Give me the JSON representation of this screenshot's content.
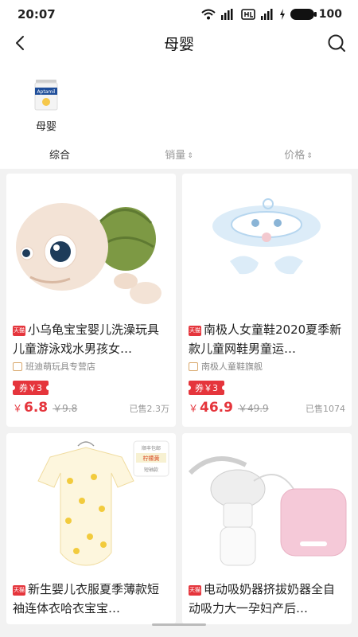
{
  "status_bar": {
    "time": "20:07",
    "battery": "100"
  },
  "header": {
    "title": "母婴"
  },
  "category": {
    "label": "母婴",
    "thumb_brand": "Aptamil"
  },
  "sort_tabs": [
    {
      "label": "综合"
    },
    {
      "label": "销量",
      "arrows": "⇕"
    },
    {
      "label": "价格",
      "arrows": "⇕"
    }
  ],
  "tmall_badge": "天猫",
  "products": [
    {
      "title": "小乌龟宝宝婴儿洗澡玩具儿童游泳戏水男孩女…",
      "shop": "班迪萌玩具专营店",
      "coupon": "券￥3",
      "price_symbol": "￥",
      "price": "6.8",
      "original_price": "￥9.8",
      "sold": "已售2.3万"
    },
    {
      "title": "南极人女童鞋2020夏季新款儿童网鞋男童运…",
      "shop": "南极人童鞋旗舰",
      "coupon": "券￥3",
      "price_symbol": "￥",
      "price": "46.9",
      "original_price": "￥49.9",
      "sold": "已售1074"
    },
    {
      "title": "新生婴儿衣服夏季薄款短袖连体衣哈衣宝宝…",
      "image_tag_top": "顺丰包邮",
      "image_tag_mid": "柠檬黄",
      "image_tag_bot": "短袖款"
    },
    {
      "title": "电动吸奶器挤拔奶器全自动吸力大一孕妇产后…"
    }
  ],
  "colors": {
    "accent": "#e5353c",
    "background": "#f2f2f2"
  }
}
